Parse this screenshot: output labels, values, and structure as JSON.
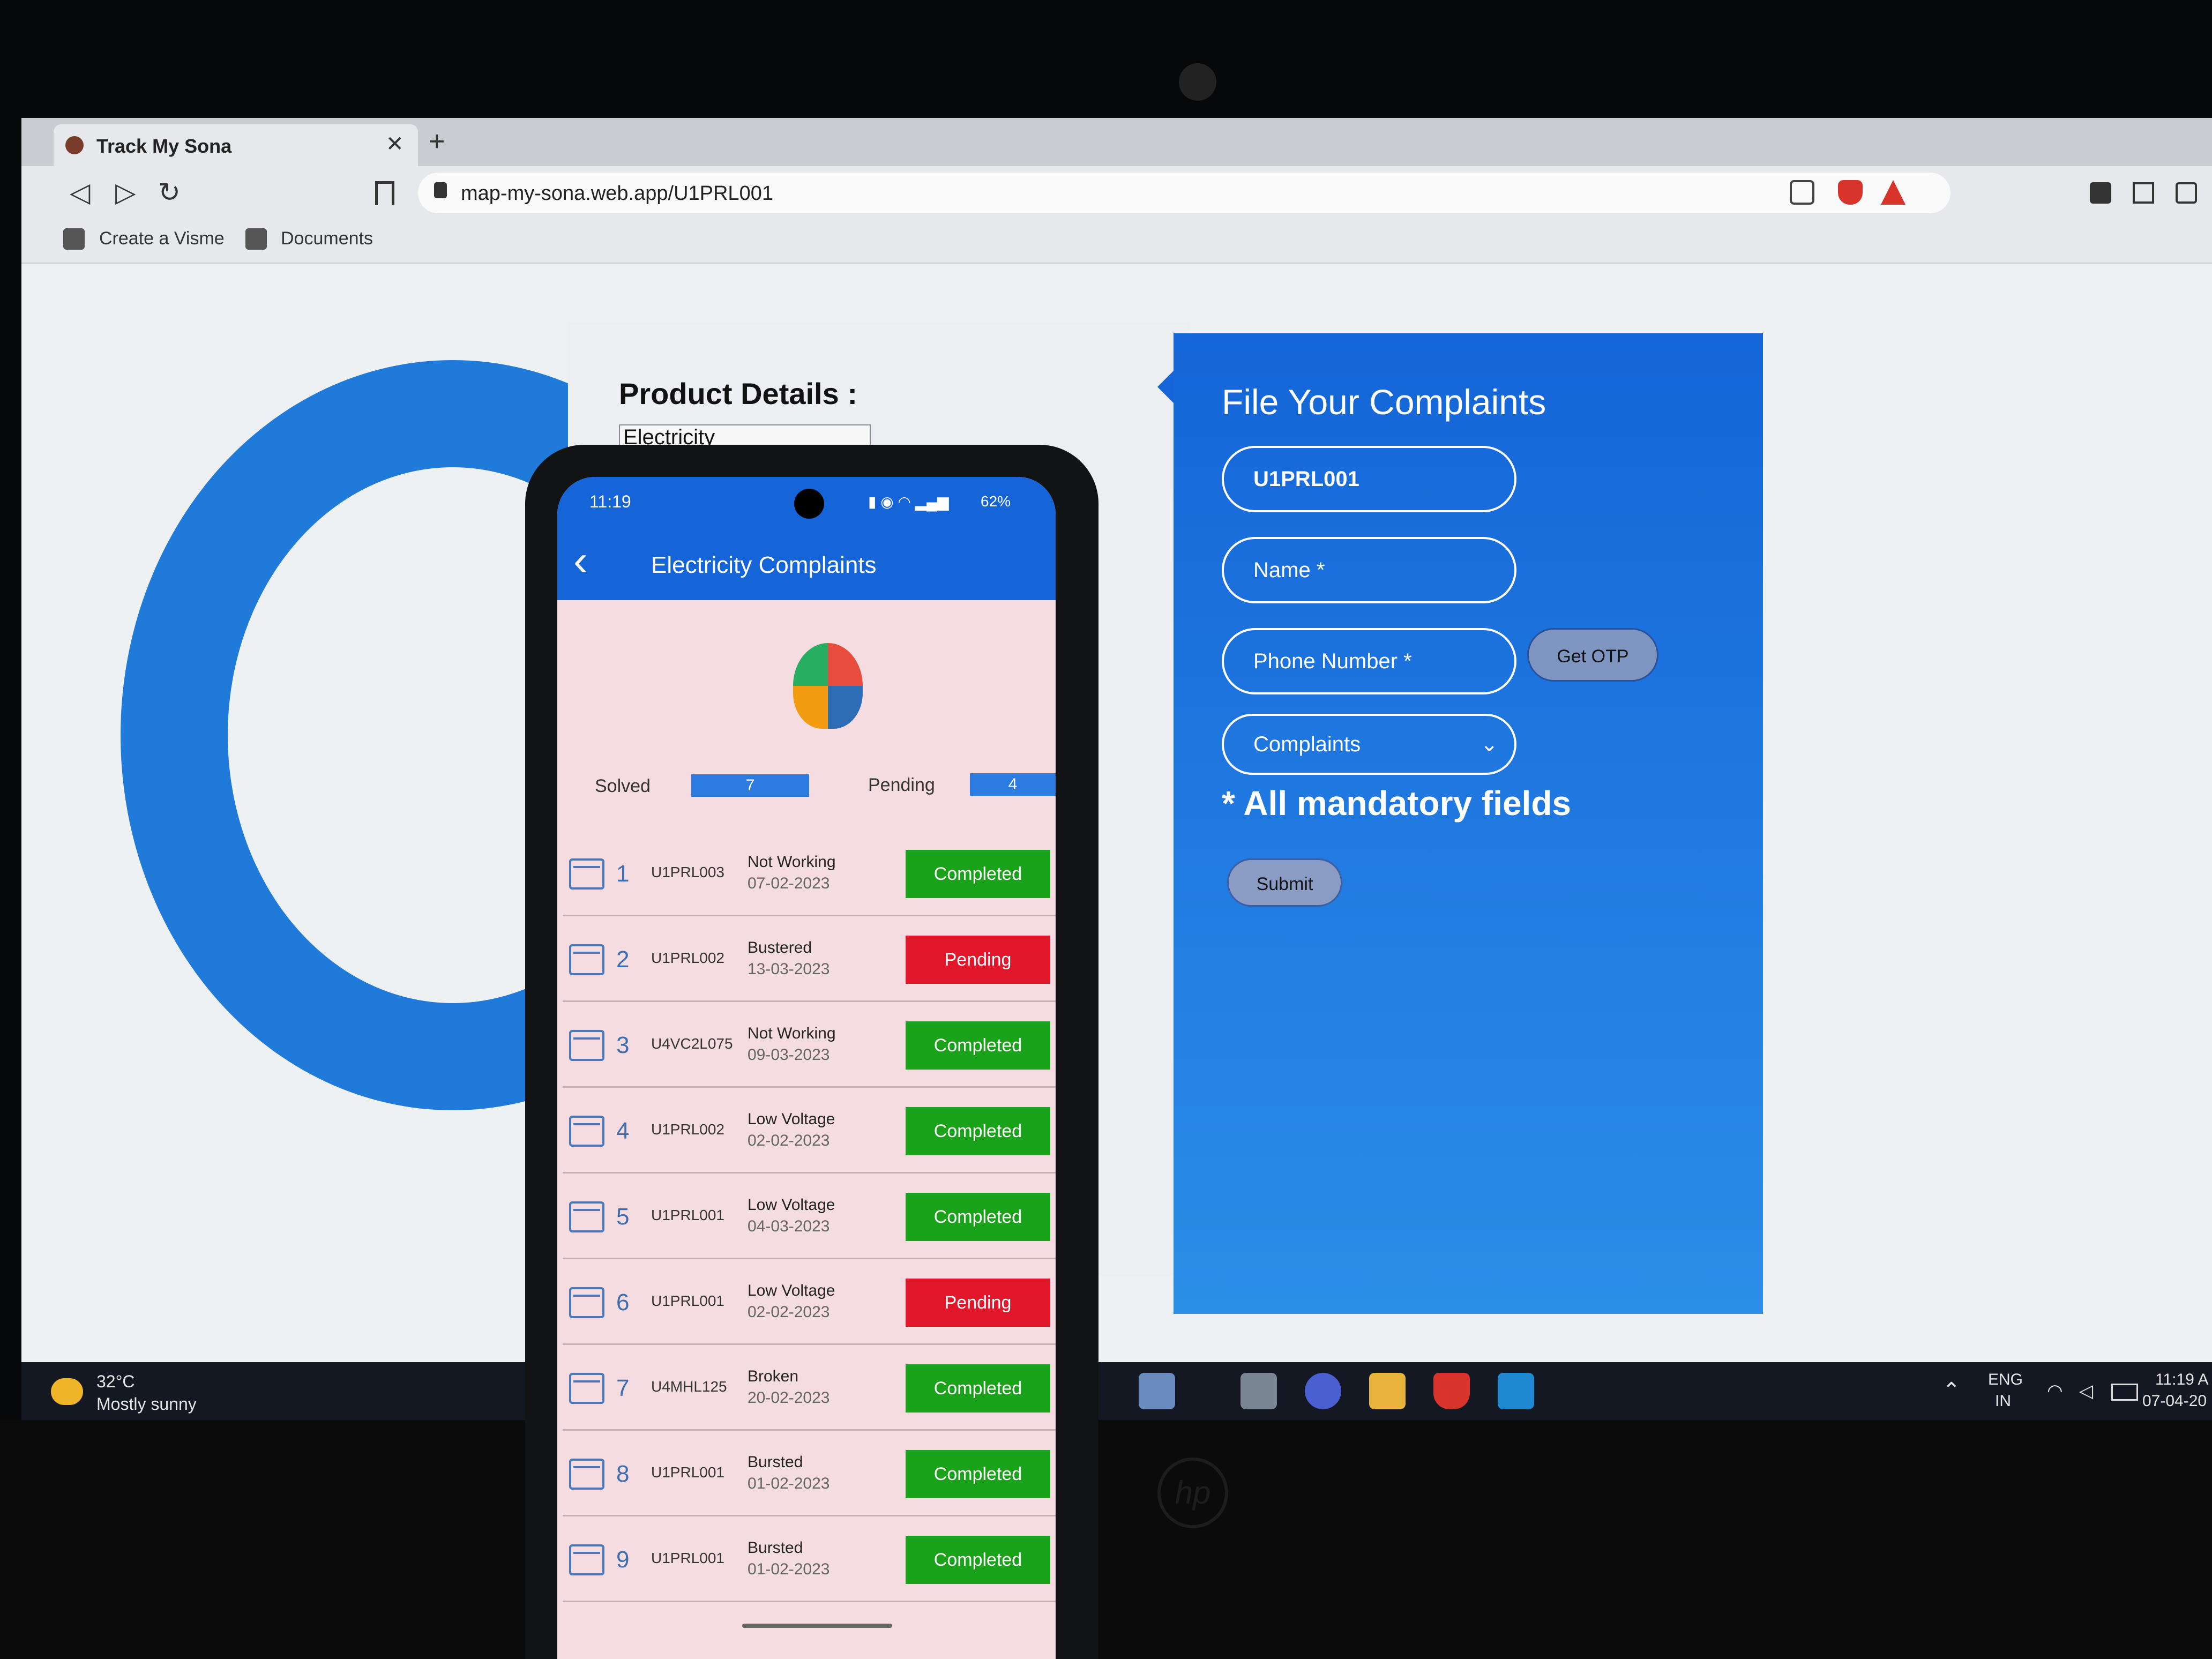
{
  "browser": {
    "tab_title": "Track My Sona",
    "tab_close": "✕",
    "new_tab": "+",
    "back": "◁",
    "forward": "▷",
    "reload": "↻",
    "url": "map-my-sona.web.app/U1PRL001",
    "bookmarks": [
      {
        "label": "Create a Visme",
        "icon": "visme-icon"
      },
      {
        "label": "Documents",
        "icon": "documents-icon"
      }
    ]
  },
  "product": {
    "title": "Product Details :",
    "value": "Electricity"
  },
  "form": {
    "title": "File Your Complaints",
    "id_value": "U1PRL001",
    "name_placeholder": "Name *",
    "phone_placeholder": "Phone Number *",
    "otp_label": "Get OTP",
    "complaints_label": "Complaints",
    "mandatory": "* All mandatory fields",
    "submit_label": "Submit"
  },
  "taskbar": {
    "temp": "32°C",
    "weather": "Mostly sunny",
    "lang1": "ENG",
    "lang2": "IN",
    "time": "11:19 A",
    "date": "07-04-20"
  },
  "phone": {
    "time": "11:19",
    "battery": "62%",
    "title": "Electricity Complaints",
    "back": "‹",
    "solved_label": "Solved",
    "solved_count": "7",
    "pending_label": "Pending",
    "pending_count": "4",
    "complaints": [
      {
        "n": "1",
        "id": "U1PRL003",
        "issue": "Not Working",
        "date": "07-02-2023",
        "status": "Completed"
      },
      {
        "n": "2",
        "id": "U1PRL002",
        "issue": "Bustered",
        "date": "13-03-2023",
        "status": "Pending"
      },
      {
        "n": "3",
        "id": "U4VC2L075",
        "issue": "Not Working",
        "date": "09-03-2023",
        "status": "Completed"
      },
      {
        "n": "4",
        "id": "U1PRL002",
        "issue": "Low Voltage",
        "date": "02-02-2023",
        "status": "Completed"
      },
      {
        "n": "5",
        "id": "U1PRL001",
        "issue": "Low Voltage",
        "date": "04-03-2023",
        "status": "Completed"
      },
      {
        "n": "6",
        "id": "U1PRL001",
        "issue": "Low Voltage",
        "date": "02-02-2023",
        "status": "Pending"
      },
      {
        "n": "7",
        "id": "U4MHL125",
        "issue": "Broken",
        "date": "20-02-2023",
        "status": "Completed"
      },
      {
        "n": "8",
        "id": "U1PRL001",
        "issue": "Bursted",
        "date": "01-02-2023",
        "status": "Completed"
      },
      {
        "n": "9",
        "id": "U1PRL001",
        "issue": "Bursted",
        "date": "01-02-2023",
        "status": "Completed"
      }
    ]
  },
  "colors": {
    "primary_blue": "#1565d8",
    "completed": "#1aa31a",
    "pending": "#e0162b"
  }
}
